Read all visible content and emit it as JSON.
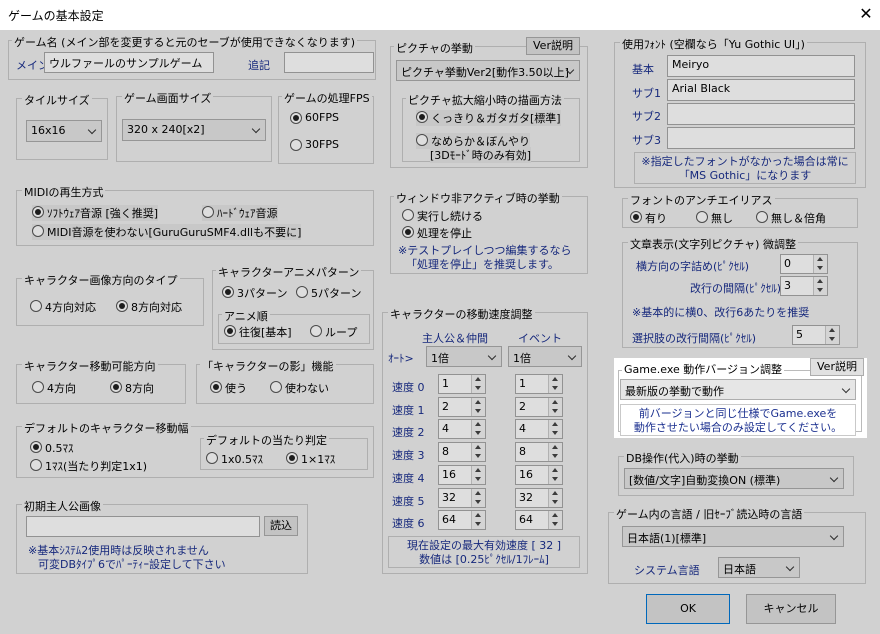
{
  "window": {
    "title": "ゲームの基本設定",
    "close": "✕"
  },
  "game_name": {
    "group": "ゲーム名 (メイン部を変更すると元のセーブが使用できなくなります)",
    "main_label": "メイン",
    "main_value": "ウルファールのサンプルゲーム",
    "extra_label": "追記",
    "extra_value": ""
  },
  "tile_size": {
    "group": "タイルサイズ",
    "value": "16x16"
  },
  "screen_size": {
    "group": "ゲーム画面サイズ",
    "value": "320 x 240[x2]"
  },
  "fps": {
    "group": "ゲームの処理FPS",
    "opt1": "60FPS",
    "opt2": "30FPS"
  },
  "midi": {
    "group": "MIDIの再生方式",
    "opt1": "ｿﾌﾄｳｪｱ音源 [強く推奨]",
    "opt2": "ﾊｰﾄﾞｳｪｱ音源",
    "opt3": "MIDI音源を使わない[GuruGuruSMF4.dllも不要に]"
  },
  "char_dir_type": {
    "group": "キャラクター画像方向のタイプ",
    "opt1": "4方向対応",
    "opt2": "8方向対応"
  },
  "char_anim": {
    "group": "キャラクターアニメパターン",
    "opt1": "3パターン",
    "opt2": "5パターン",
    "order_group": "アニメ順",
    "order1": "往復[基本]",
    "order2": "ループ"
  },
  "char_move_dir": {
    "group": "キャラクター移動可能方向",
    "opt1": "4方向",
    "opt2": "8方向"
  },
  "char_shadow": {
    "group": "「キャラクターの影」機能",
    "opt1": "使う",
    "opt2": "使わない"
  },
  "move_width": {
    "group": "デフォルトのキャラクター移動幅",
    "opt1": "0.5ﾏｽ",
    "opt2": "1ﾏｽ(当たり判定1x1)",
    "hit_group": "デフォルトの当たり判定",
    "hit1": "1x0.5ﾏｽ",
    "hit2": "1×1ﾏｽ"
  },
  "initial_hero": {
    "group": "初期主人公画像",
    "value": "",
    "load_button": "読込",
    "note1": "※基本ｼｽﾃﾑ2使用時は反映されません",
    "note2": "可変DBﾀｲﾌﾟ6でﾊﾟｰﾃｨｰ設定して下さい"
  },
  "picture": {
    "group": "ピクチャの挙動",
    "ver_button": "Ver説明",
    "value": "ピクチャ挙動Ver2[動作3.50以上]",
    "scale_group": "ピクチャ拡大縮小時の描画方法",
    "scale1": "くっきり＆ガタガタ[標準]",
    "scale2a": "なめらか＆ぼんやり",
    "scale2b": "[3Dﾓｰﾄﾞ時のみ有効]"
  },
  "inactive": {
    "group": "ウィンドウ非アクティブ時の挙動",
    "opt1": "実行し続ける",
    "opt2": "処理を停止",
    "note1": "※テストプレイしつつ編集するなら",
    "note2": "「処理を停止」を推奨します。"
  },
  "speed": {
    "group": "キャラクターの移動速度調整",
    "col_hero": "主人公＆仲間",
    "col_event": "イベント",
    "auto_label": "ｵｰﾄ>",
    "auto_hero": "1倍",
    "auto_event": "1倍",
    "rows": [
      {
        "label": "速度 0",
        "hero": "1",
        "event": "1"
      },
      {
        "label": "速度 1",
        "hero": "2",
        "event": "2"
      },
      {
        "label": "速度 2",
        "hero": "4",
        "event": "4"
      },
      {
        "label": "速度 3",
        "hero": "8",
        "event": "8"
      },
      {
        "label": "速度 4",
        "hero": "16",
        "event": "16"
      },
      {
        "label": "速度 5",
        "hero": "32",
        "event": "32"
      },
      {
        "label": "速度 6",
        "hero": "64",
        "event": "64"
      }
    ],
    "note1": "現在設定の最大有効速度 [ 32 ]",
    "note2": "数値は [0.25ﾋﾟｸｾﾙ/1ﾌﾚｰﾑ]"
  },
  "font": {
    "group": "使用ﾌｫﾝﾄ (空欄なら「Yu Gothic UI」)",
    "base_label": "基本",
    "base_value": "Meiryo",
    "sub1_label": "サブ1",
    "sub1_value": "Arial Black",
    "sub2_label": "サブ2",
    "sub2_value": "",
    "sub3_label": "サブ3",
    "sub3_value": "",
    "note1": "※指定したフォントがなかった場合は常に",
    "note2": "「MS Gothic」になります"
  },
  "antialias": {
    "group": "フォントのアンチエイリアス",
    "opt1": "有り",
    "opt2": "無し",
    "opt3": "無し＆倍角"
  },
  "text_display": {
    "group": "文章表示(文字列ピクチャ) 微調整",
    "hspace_label": "横方向の字詰め(ﾋﾟｸｾﾙ)",
    "hspace_value": "0",
    "lspace_label": "改行の間隔(ﾋﾟｸｾﾙ)",
    "lspace_value": "3",
    "note": "※基本的に横0、改行6あたりを推奨",
    "choice_label": "選択肢の改行間隔(ﾋﾟｸｾﾙ)",
    "choice_value": "5"
  },
  "game_exe": {
    "group": "Game.exe 動作バージョン調整",
    "ver_button": "Ver説明",
    "value": "最新版の挙動で動作",
    "note1": "前バージョンと同じ仕様でGame.exeを",
    "note2": "動作させたい場合のみ設定してください。"
  },
  "db_op": {
    "group": "DB操作(代入)時の挙動",
    "value": "[数値/文字]自動変換ON (標準)"
  },
  "language": {
    "group": "ゲーム内の言語 / 旧ｾｰﾌﾞ読込時の言語",
    "value": "日本語(1)[標準]",
    "sys_label": "システム言語",
    "sys_value": "日本語"
  },
  "buttons": {
    "ok": "OK",
    "cancel": "キャンセル"
  }
}
